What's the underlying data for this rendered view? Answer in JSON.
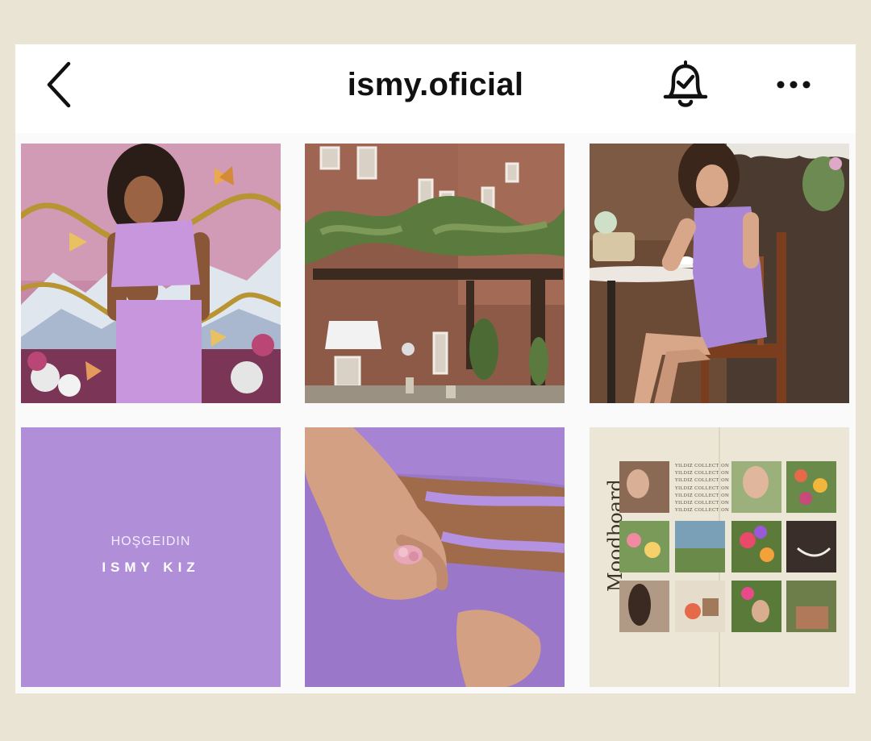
{
  "header": {
    "title": "ismy.oficial",
    "back_icon": "chevron-left-icon",
    "notification_icon": "bell-check-icon",
    "more_icon": "more-horizontal-icon"
  },
  "posts": {
    "welcome": {
      "line1": "HOŞGEIDIN",
      "line2": "ISMY KIZ",
      "background": "#b08fd8"
    },
    "moodboard": {
      "title": "Moodboard",
      "collection_lines": [
        "YILDIZ COLLECTION",
        "YILDIZ COLLECTION",
        "YILDIZ COLLECTION",
        "YILDIZ COLLECTION",
        "YILDIZ COLLECTION",
        "YILDIZ COLLECTION",
        "YILDIZ COLLECTION"
      ]
    }
  },
  "colors": {
    "page_background": "#e9e4d3",
    "accent_lilac": "#b08fd8"
  }
}
